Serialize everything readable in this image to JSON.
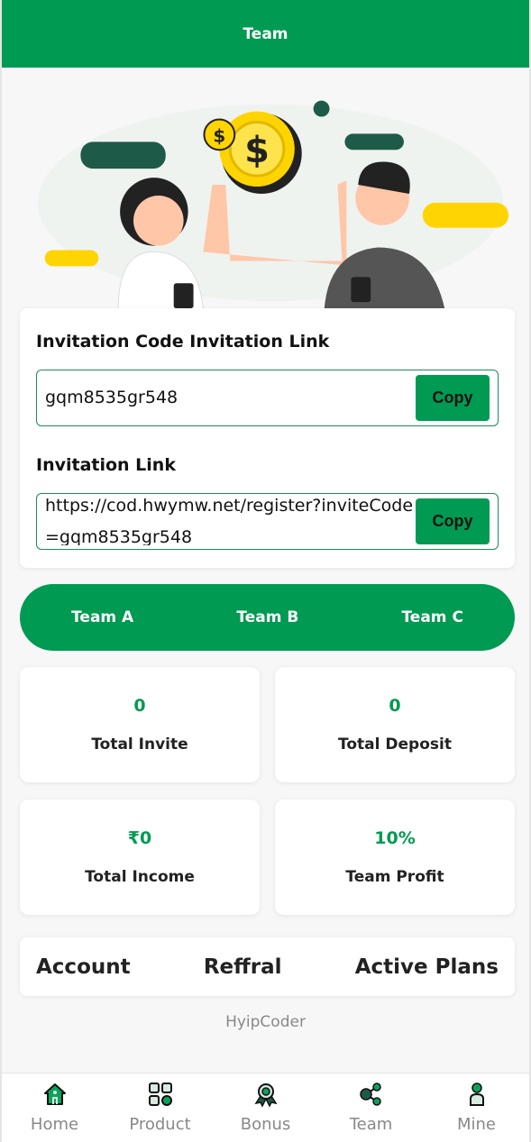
{
  "header": {
    "title": "Team"
  },
  "invite": {
    "code_title": "Invitation Code Invitation Link",
    "code": "gqm8535gr548",
    "copy_label": "Copy",
    "link_title": "Invitation Link",
    "link": "https://cod.hwymw.net/register?inviteCode=gqm8535gr548"
  },
  "teams": [
    "Team A",
    "Team B",
    "Team C"
  ],
  "stats": [
    {
      "value": "0",
      "label": "Total Invite"
    },
    {
      "value": "0",
      "label": "Total Deposit"
    },
    {
      "value": "₹0",
      "label": "Total Income"
    },
    {
      "value": "10%",
      "label": "Team Profit"
    }
  ],
  "links": [
    "Account",
    "Reffral",
    "Active Plans"
  ],
  "brand": "HyipCoder",
  "nav": [
    {
      "label": "Home",
      "icon": "home-icon"
    },
    {
      "label": "Product",
      "icon": "grid-icon"
    },
    {
      "label": "Bonus",
      "icon": "award-icon"
    },
    {
      "label": "Team",
      "icon": "share-icon"
    },
    {
      "label": "Mine",
      "icon": "user-icon"
    }
  ],
  "colors": {
    "primary": "#009a52"
  }
}
